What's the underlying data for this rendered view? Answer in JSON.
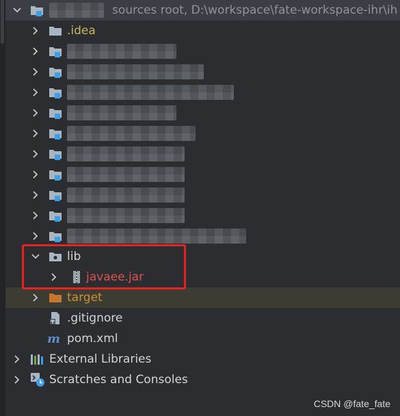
{
  "root": {
    "suffix": "sources root,  D:\\workspace\\fate-workspace-ihr\\ih"
  },
  "tree": {
    "idea": ".idea",
    "lib": "lib",
    "javaee": "javaee.jar",
    "target": "target",
    "gitignore": ".gitignore",
    "pom": "pom.xml",
    "external": "External Libraries",
    "scratches": "Scratches and Consoles"
  },
  "watermark": "CSDN @fate_fate",
  "colors": {
    "background": "#2b2d30",
    "folder": "#a9b5c1",
    "module_badge": "#3e9ee6",
    "highlight": "#e8231f",
    "excluded_folder": "#c6762f"
  }
}
